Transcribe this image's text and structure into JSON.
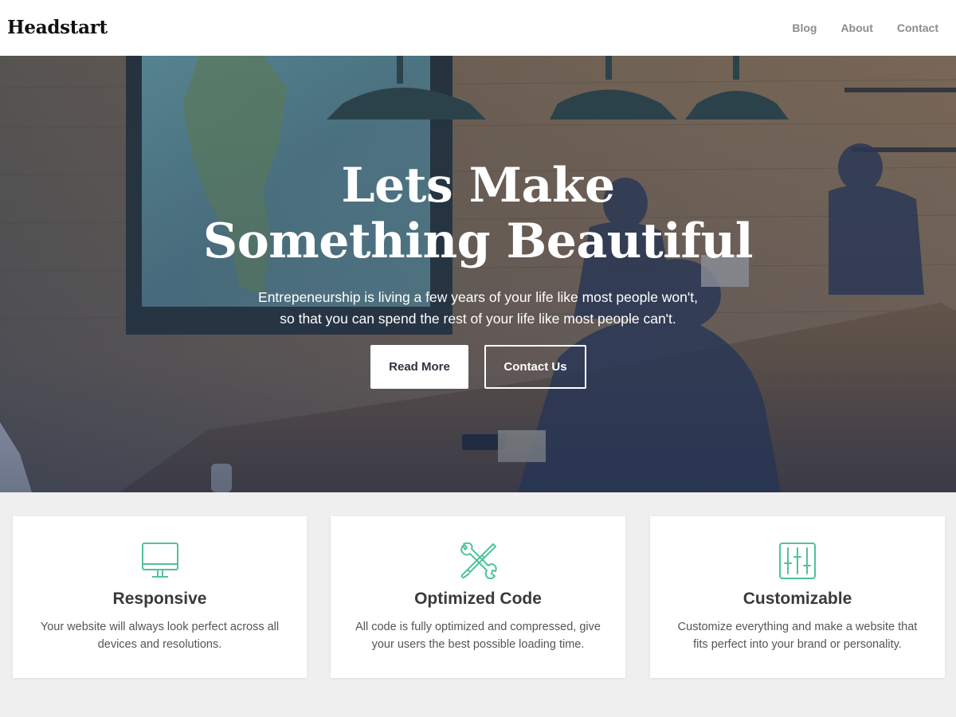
{
  "header": {
    "brand": "Headstart",
    "nav": [
      {
        "label": "Blog"
      },
      {
        "label": "About"
      },
      {
        "label": "Contact"
      }
    ]
  },
  "hero": {
    "title_line1": "Lets Make",
    "title_line2": "Something Beautiful",
    "subtitle_line1": "Entrepeneurship is living a few years of your life like most people won't,",
    "subtitle_line2": "so that you can spend the rest of your life like most people can't.",
    "read_more_label": "Read More",
    "contact_us_label": "Contact Us"
  },
  "features": [
    {
      "icon": "monitor-icon",
      "title": "Responsive",
      "desc_line1": "Your website will always look perfect across all",
      "desc_line2": "devices and resolutions."
    },
    {
      "icon": "tools-icon",
      "title": "Optimized Code",
      "desc_line1": "All code is fully optimized and compressed, give",
      "desc_line2": "your users the best possible loading time."
    },
    {
      "icon": "sliders-icon",
      "title": "Customizable",
      "desc_line1": "Customize everything and make a website that",
      "desc_line2": "fits perfect into your brand or personality."
    }
  ],
  "colors": {
    "accent": "#4fc39a",
    "page_bg": "#efefef",
    "button_text": "#2e3340"
  }
}
